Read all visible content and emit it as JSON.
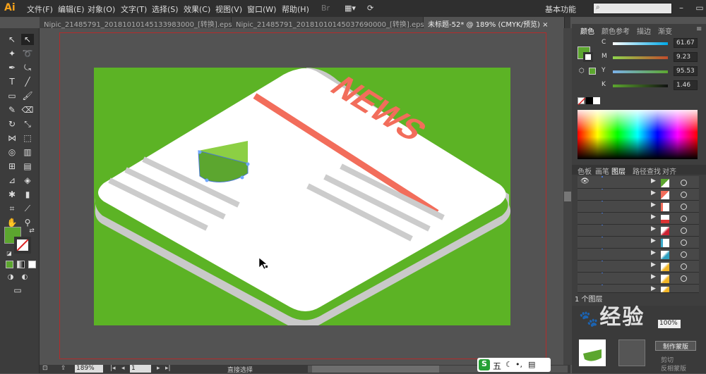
{
  "app": {
    "logo": "Ai",
    "workspace": "基本功能"
  },
  "menu": [
    "文件(F)",
    "编辑(E)",
    "对象(O)",
    "文字(T)",
    "选择(S)",
    "效果(C)",
    "视图(V)",
    "窗口(W)",
    "帮助(H)"
  ],
  "tabs": [
    {
      "label": "Nipic_21485791_20181010145133983000_[转换].eps*",
      "active": false
    },
    {
      "label": "Nipic_21485791_20181010145037690000_[转换].eps*",
      "active": false
    },
    {
      "label": "未标题-52* @ 189% (CMYK/预览)",
      "active": true
    }
  ],
  "artwork": {
    "headline": "NEWS",
    "background_color": "#5cb325"
  },
  "color_panel": {
    "tabs": [
      "颜色",
      "颜色参考",
      "描边",
      "渐变"
    ],
    "sliders": [
      {
        "label": "C",
        "value": "61.67"
      },
      {
        "label": "M",
        "value": "9.23"
      },
      {
        "label": "Y",
        "value": "95.53"
      },
      {
        "label": "K",
        "value": "1.46"
      }
    ],
    "fill_color": "#5ca62f"
  },
  "layers_panel": {
    "tabs": [
      "色板",
      "画笔",
      "图层",
      "路径查找",
      "对齐"
    ],
    "count_label": "1 个图层",
    "rows": 10
  },
  "status": {
    "zoom": "189%",
    "page": "1",
    "tool": "直接选择"
  },
  "bottom_panel": {
    "opacity": "100%",
    "make_mask": "制作蒙版",
    "clip": "剪切",
    "invert_mask": "反相蒙版"
  },
  "watermark": "经验",
  "ime": {
    "label": "五"
  }
}
